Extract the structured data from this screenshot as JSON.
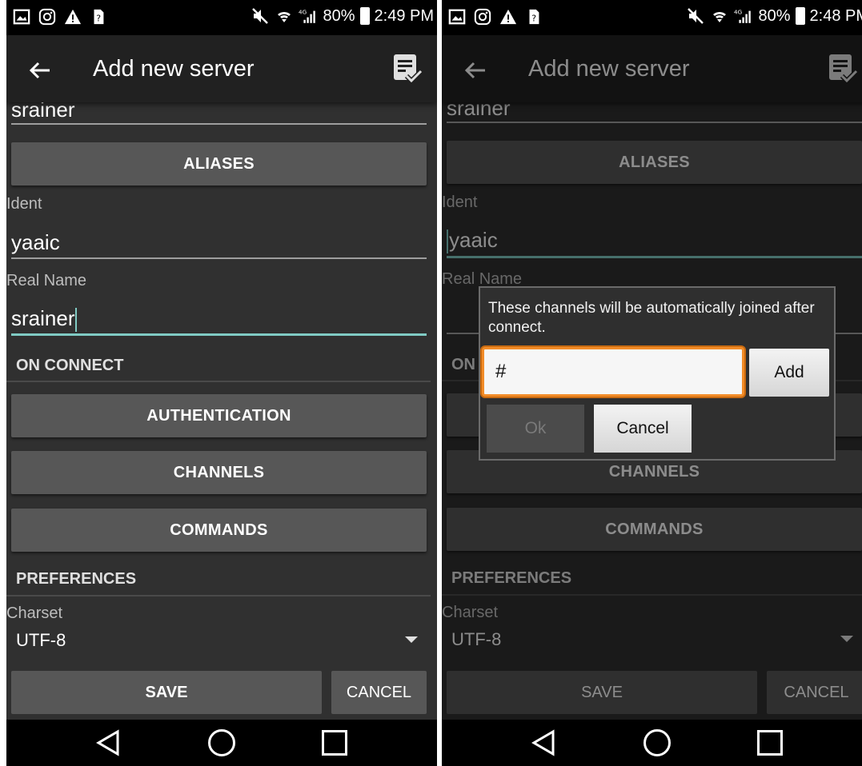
{
  "status_bar_left": {
    "battery": "80%",
    "time": "2:49 PM",
    "network": "4G"
  },
  "status_bar_right": {
    "battery": "80%",
    "time": "2:48 PM",
    "network": "4G"
  },
  "app_bar": {
    "title": "Add new server"
  },
  "form": {
    "nickname_value": "srainer",
    "aliases_label": "ALIASES",
    "ident_label": "Ident",
    "ident_value": "yaaic",
    "realname_label": "Real Name",
    "realname_value": "srainer",
    "on_connect_header": "ON CONNECT",
    "authentication_label": "AUTHENTICATION",
    "channels_label": "CHANNELS",
    "commands_label": "COMMANDS",
    "preferences_header": "PREFERENCES",
    "charset_label": "Charset",
    "charset_value": "UTF-8",
    "save_label": "SAVE",
    "cancel_label": "CANCEL"
  },
  "dialog": {
    "message": "These channels will be automatically joined after connect.",
    "input_value": "#",
    "add_label": "Add",
    "ok_label": "Ok",
    "cancel_label": "Cancel"
  },
  "colors": {
    "background": "#303030",
    "app_bar": "#212121",
    "button": "#575757",
    "focus_underline": "#80cbc4",
    "input_focus_border": "#f28c28"
  },
  "icons": [
    "image-icon",
    "instagram-icon",
    "warning-icon",
    "sim-icon",
    "mute-icon",
    "wifi-icon",
    "signal-icon",
    "battery-icon",
    "back-arrow-icon",
    "save-checklist-icon",
    "nav-back-icon",
    "nav-home-icon",
    "nav-recents-icon"
  ]
}
